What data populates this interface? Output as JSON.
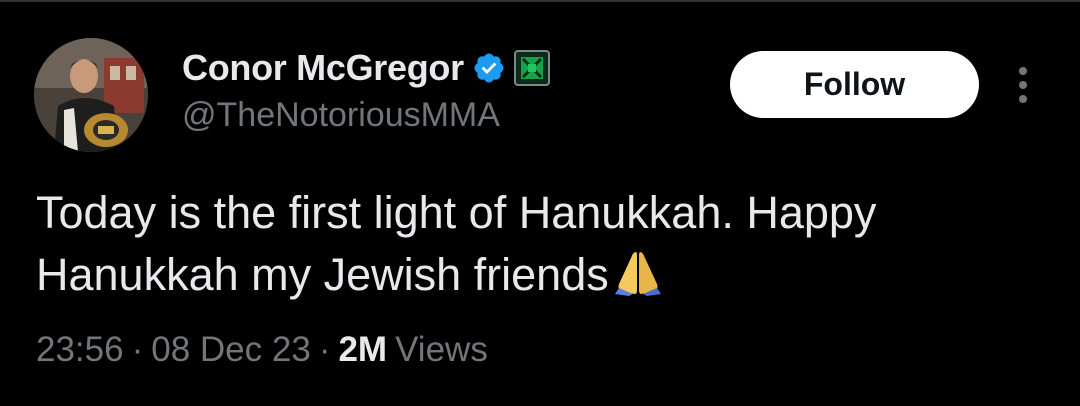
{
  "colors": {
    "background": "#000000",
    "primary_text": "#e7e9ea",
    "secondary_text": "#71767b",
    "verified_blue": "#1d9bf0",
    "follow_bg": "#ffffff",
    "follow_text": "#0f1419",
    "affiliate_green": "#16a34a"
  },
  "author": {
    "display_name": "Conor McGregor",
    "handle": "@TheNotoriousMMA",
    "verified_icon": "verified-badge-icon",
    "affiliate_icon": "affiliate-badge-icon",
    "avatar_icon": "profile-photo"
  },
  "actions": {
    "follow_label": "Follow",
    "more_icon": "more-vertical-icon"
  },
  "tweet": {
    "text": "Today is the first light of Hanukkah. Happy Hanukkah my Jewish friends",
    "emoji_icon": "folded-hands-emoji"
  },
  "meta": {
    "time": "23:56",
    "separator": "·",
    "date": "08 Dec 23",
    "views_count": "2M",
    "views_label": "Views"
  }
}
